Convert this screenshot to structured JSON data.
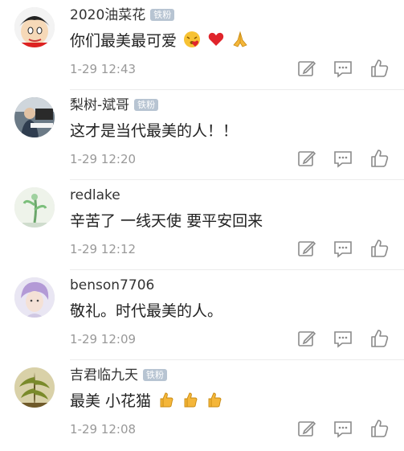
{
  "comments": [
    {
      "username": "2020油菜花",
      "badge": "铁粉",
      "text": "你们最美最可爱",
      "emojis": [
        "love-face",
        "heart",
        "pray"
      ],
      "time": "1-29 12:43"
    },
    {
      "username": "梨树-斌哥",
      "badge": "铁粉",
      "text": "这才是当代最美的人！！",
      "emojis": [],
      "time": "1-29 12:20"
    },
    {
      "username": "redlake",
      "badge": "",
      "text": "辛苦了 一线天使 要平安回来",
      "emojis": [],
      "time": "1-29 12:12"
    },
    {
      "username": "benson7706",
      "badge": "",
      "text": "敬礼。时代最美的人。",
      "emojis": [],
      "time": "1-29 12:09"
    },
    {
      "username": "吉君临九天",
      "badge": "铁粉",
      "text": "最美 小花猫",
      "emojis": [
        "thumbs-up",
        "thumbs-up",
        "thumbs-up"
      ],
      "time": "1-29 12:08"
    }
  ],
  "colors": {
    "text": "#222222",
    "meta": "#999999",
    "badge": "#b7c4d2",
    "icon": "#8a8a8a",
    "heart": "#e0242b"
  }
}
